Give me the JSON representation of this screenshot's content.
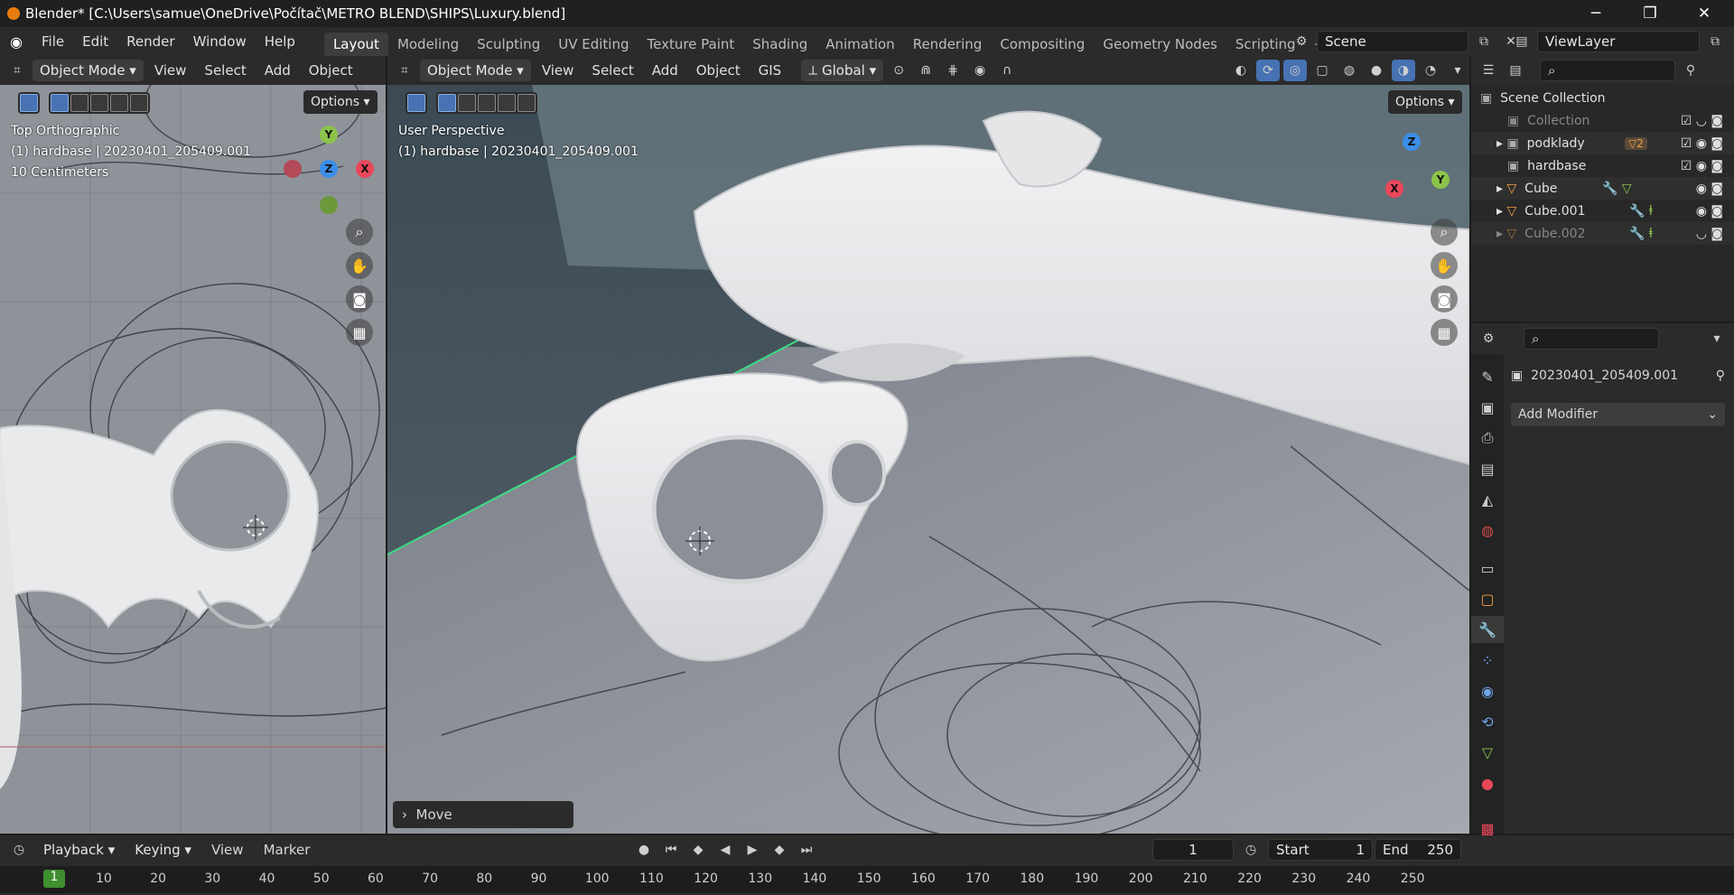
{
  "window": {
    "title": "Blender* [C:\\Users\\samue\\OneDrive\\Počítač\\METRO BLEND\\SHIPS\\Luxury.blend]",
    "minimize": "─",
    "restore": "❐",
    "close": "✕"
  },
  "menu": {
    "items": [
      "File",
      "Edit",
      "Render",
      "Window",
      "Help"
    ]
  },
  "workspaces": {
    "tabs": [
      "Layout",
      "Modeling",
      "Sculpting",
      "UV Editing",
      "Texture Paint",
      "Shading",
      "Animation",
      "Rendering",
      "Compositing",
      "Geometry Nodes",
      "Scripting"
    ],
    "add": "+",
    "active": "Layout"
  },
  "scene": {
    "label": "Scene",
    "viewlayer": "ViewLayer"
  },
  "left_viewport": {
    "mode": "Object Mode",
    "menus": [
      "View",
      "Select",
      "Add",
      "Object"
    ],
    "options": "Options",
    "info": [
      "Top Orthographic",
      "(1) hardbase | 20230401_205409.001",
      "10 Centimeters"
    ]
  },
  "main_viewport": {
    "mode": "Object Mode",
    "menus": [
      "View",
      "Select",
      "Add",
      "Object",
      "GIS"
    ],
    "orientation": "Global",
    "options": "Options",
    "info": [
      "User Perspective",
      "(1) hardbase | 20230401_205409.001"
    ],
    "operator_panel": "Move"
  },
  "gizmo": {
    "x": "X",
    "y": "Y",
    "z": "Z"
  },
  "outliner": {
    "root": "Scene Collection",
    "rows": [
      {
        "name": "Collection",
        "dim": true,
        "arrow": ""
      },
      {
        "name": "podklady",
        "dim": false,
        "arrow": "▸",
        "badge": "2"
      },
      {
        "name": "hardbase",
        "dim": false,
        "arrow": ""
      },
      {
        "name": "Cube",
        "dim": false,
        "arrow": "▸"
      },
      {
        "name": "Cube.001",
        "dim": false,
        "arrow": "▸"
      },
      {
        "name": "Cube.002",
        "dim": true,
        "arrow": "▸"
      }
    ]
  },
  "properties": {
    "object_name": "20230401_205409.001",
    "add_modifier": "Add Modifier"
  },
  "timeline": {
    "menus": [
      "Playback",
      "Keying",
      "View",
      "Marker"
    ],
    "current_frame": "1",
    "start_label": "Start",
    "start": "1",
    "end_label": "End",
    "end": "250",
    "ticks": [
      "10",
      "20",
      "30",
      "40",
      "50",
      "60",
      "70",
      "80",
      "90",
      "100",
      "110",
      "120",
      "130",
      "140",
      "150",
      "160",
      "170",
      "180",
      "190",
      "200",
      "210",
      "220",
      "230",
      "240",
      "250"
    ]
  },
  "colors": {
    "accent": "#4772b3",
    "x_axis": "#e8475a",
    "y_axis": "#8bc34a",
    "z_axis": "#3b8ee8",
    "selection": "#3ddc84",
    "frame": "#3f8f30"
  }
}
